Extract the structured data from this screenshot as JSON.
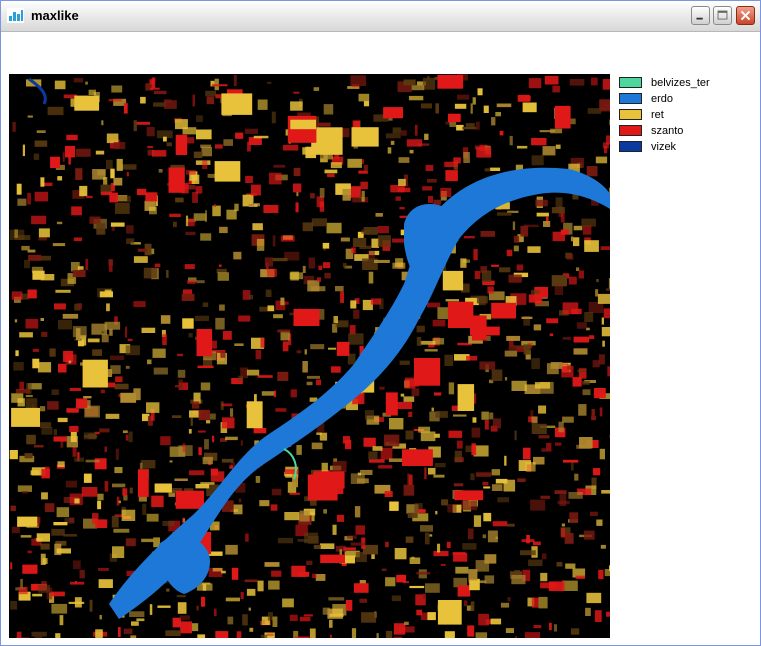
{
  "window": {
    "title": "maxlike",
    "icon": "chart-app-icon"
  },
  "legend": {
    "items": [
      {
        "label": "belvizes_ter",
        "color": "#4fd69c"
      },
      {
        "label": "erdo",
        "color": "#1e78d8"
      },
      {
        "label": "ret",
        "color": "#e8c23a"
      },
      {
        "label": "szanto",
        "color": "#e01818"
      },
      {
        "label": "vizek",
        "color": "#0a3aa0"
      }
    ]
  },
  "colors": {
    "background": "#000000"
  }
}
